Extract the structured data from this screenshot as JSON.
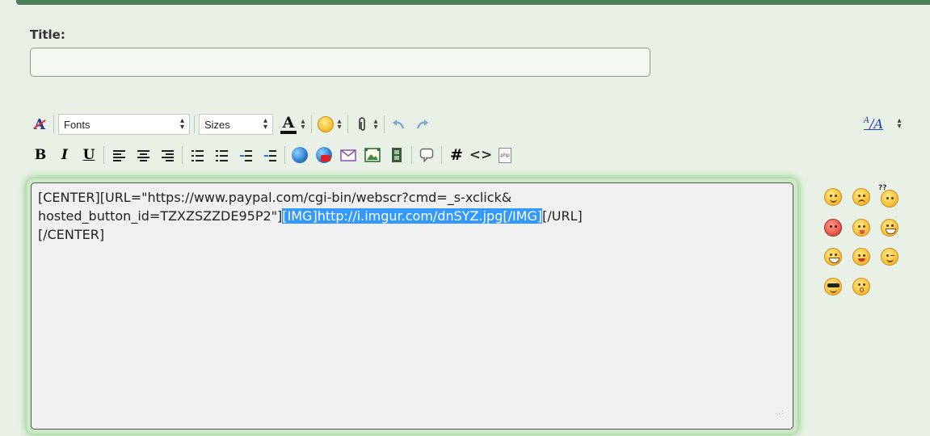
{
  "form": {
    "title_label": "Title:",
    "title_value": ""
  },
  "toolbar": {
    "font_select": "Fonts",
    "size_select": "Sizes",
    "bold": "B",
    "italic": "I",
    "underline": "U",
    "hash": "#",
    "code": "<>",
    "php": "php",
    "font_color_glyph": "A",
    "remove_format_glyph": "A",
    "resize_glyph": "A"
  },
  "editor": {
    "text_line1": "[CENTER][URL=\"https://www.paypal.com/cgi-bin/webscr?cmd=_s-xclick&",
    "text_line2_pre": "hosted_button_id=TZXZSZZDE95P2\"]",
    "text_line2_selected": "[IMG]http://i.imgur.com/dnSYZ.jpg[/IMG]",
    "text_line2_post": "[/URL]",
    "text_line3": "[/CENTER]",
    "grip": "..:"
  },
  "smilies": {
    "confused_glyph": "??"
  },
  "colors": {
    "accent": "#4e7d59",
    "background": "#e9f1e6",
    "selection": "#3399ff",
    "editor_glow": "#9fd497"
  }
}
